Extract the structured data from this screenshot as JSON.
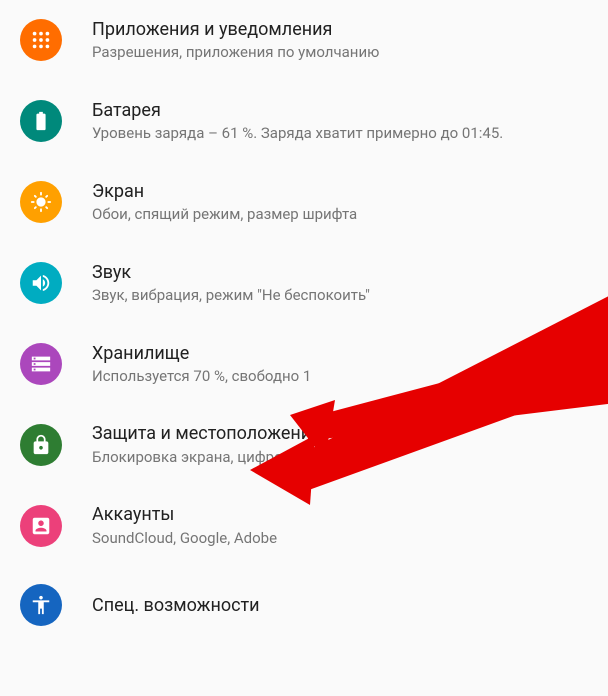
{
  "settings": {
    "items": [
      {
        "title": "Приложения и уведомления",
        "subtitle": "Разрешения, приложения по умолчанию"
      },
      {
        "title": "Батарея",
        "subtitle": "Уровень заряда – 61 %. Заряда хватит примерно до 01:45."
      },
      {
        "title": "Экран",
        "subtitle": "Обои, спящий режим, размер шрифта"
      },
      {
        "title": "Звук",
        "subtitle": "Звук, вибрация, режим \"Не беспокоить\""
      },
      {
        "title": "Хранилище",
        "subtitle": "Используется 70 %, свободно 1"
      },
      {
        "title": "Защита и местоположение",
        "subtitle": "Блокировка экрана, цифровой отпечаток"
      },
      {
        "title": "Аккаунты",
        "subtitle": "SoundCloud, Google, Adobe"
      },
      {
        "title": "Спец. возможности",
        "subtitle": ""
      }
    ]
  }
}
